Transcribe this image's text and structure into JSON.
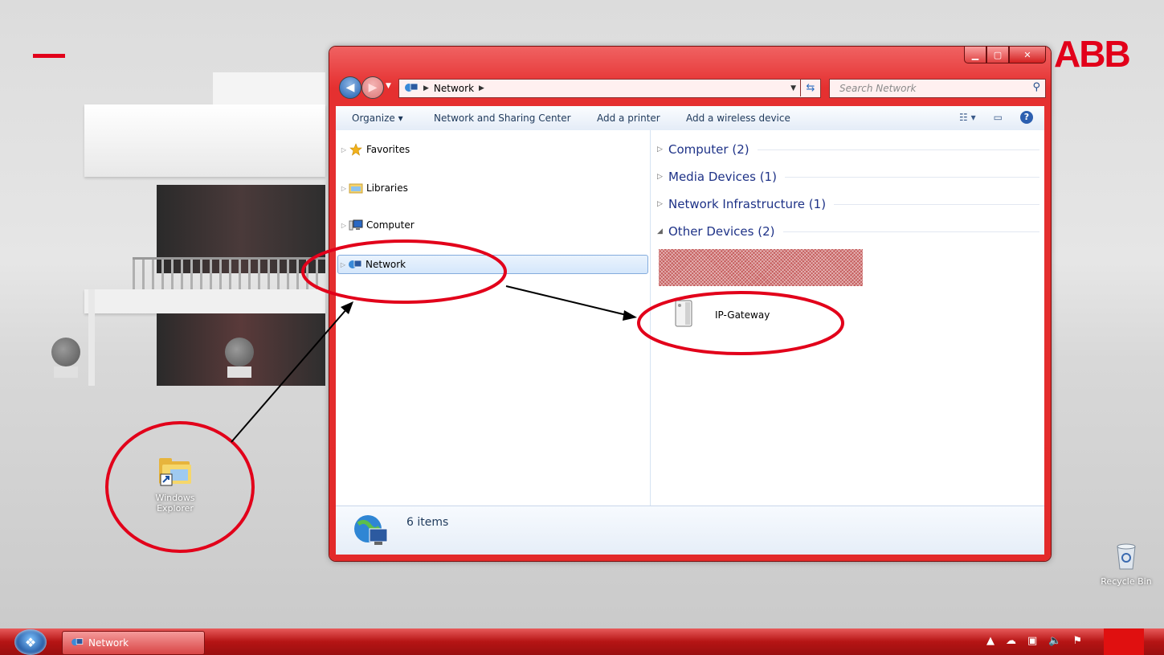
{
  "brand": {
    "logo_text": "ABB",
    "accent_color": "#e2001a"
  },
  "desktop": {
    "icons": [
      {
        "label_line1": "Windows",
        "label_line2": "Explorer",
        "icon": "windows-explorer-folder-icon"
      },
      {
        "label": "Recycle Bin",
        "icon": "recycle-bin-icon"
      }
    ]
  },
  "window": {
    "title": "Network",
    "caption_buttons": {
      "minimize": "▁",
      "maximize": "▢",
      "close": "✕"
    },
    "address": {
      "icon": "network-icon",
      "path": [
        "Network"
      ],
      "search_placeholder": "Search Network"
    },
    "toolbar": {
      "organize": "Organize ▾",
      "network_sharing": "Network and Sharing Center",
      "add_printer": "Add a printer",
      "add_wireless": "Add a wireless device"
    },
    "nav_pane": [
      {
        "label": "Favorites",
        "icon": "star-icon",
        "selected": false
      },
      {
        "label": "Libraries",
        "icon": "libraries-icon",
        "selected": false
      },
      {
        "label": "Computer",
        "icon": "computer-icon",
        "selected": false
      },
      {
        "label": "Network",
        "icon": "network-icon",
        "selected": true
      }
    ],
    "groups": [
      {
        "label": "Computer (2)",
        "expanded": false
      },
      {
        "label": "Media Devices (1)",
        "expanded": false
      },
      {
        "label": "Network Infrastructure (1)",
        "expanded": false
      },
      {
        "label": "Other Devices (2)",
        "expanded": true
      }
    ],
    "devices": [
      {
        "label": "IP-Gateway",
        "icon": "tower-device-icon"
      }
    ],
    "status": {
      "count_text": "6 items"
    }
  },
  "taskbar": {
    "start_icon": "windows-orb-icon",
    "buttons": [
      {
        "label": "Network",
        "icon": "network-icon"
      }
    ],
    "tray_icons": [
      "show-hidden-icons",
      "cloud-icon",
      "network-status-icon",
      "volume-icon",
      "action-center-icon"
    ]
  },
  "annotations": {
    "ellipse_color": "#e2001a",
    "arrow_color": "#000000"
  }
}
